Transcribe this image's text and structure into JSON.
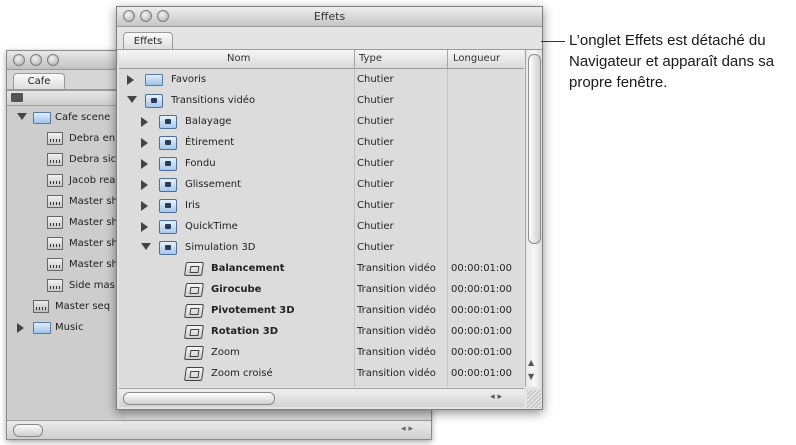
{
  "back_window": {
    "tab": "Cafe",
    "items": [
      {
        "label": "Cafe scene",
        "kind": "folder",
        "expanded": true
      },
      {
        "label": "Debra en",
        "kind": "clip"
      },
      {
        "label": "Debra sic",
        "kind": "clip"
      },
      {
        "label": "Jacob rea",
        "kind": "clip"
      },
      {
        "label": "Master sh",
        "kind": "clip"
      },
      {
        "label": "Master sh",
        "kind": "clip"
      },
      {
        "label": "Master sh",
        "kind": "clip"
      },
      {
        "label": "Master sh",
        "kind": "clip"
      },
      {
        "label": "Side mas",
        "kind": "clip"
      },
      {
        "label": "Master seq",
        "kind": "sequence"
      },
      {
        "label": "Music",
        "kind": "folder",
        "expanded": false
      }
    ]
  },
  "front_window": {
    "title": "Effets",
    "tab": "Effets",
    "columns": {
      "name": "Nom",
      "type": "Type",
      "length": "Longueur"
    },
    "rows": [
      {
        "name": "Favoris",
        "type": "Chutier",
        "length": "",
        "level": 0,
        "icon": "folder",
        "disclosure": "collapsed",
        "bold": false
      },
      {
        "name": "Transitions vidéo",
        "type": "Chutier",
        "length": "",
        "level": 0,
        "icon": "lock-folder",
        "disclosure": "expanded",
        "bold": false
      },
      {
        "name": "Balayage",
        "type": "Chutier",
        "length": "",
        "level": 1,
        "icon": "lock-folder",
        "disclosure": "collapsed",
        "bold": false
      },
      {
        "name": "Étirement",
        "type": "Chutier",
        "length": "",
        "level": 1,
        "icon": "lock-folder",
        "disclosure": "collapsed",
        "bold": false
      },
      {
        "name": "Fondu",
        "type": "Chutier",
        "length": "",
        "level": 1,
        "icon": "lock-folder",
        "disclosure": "collapsed",
        "bold": false
      },
      {
        "name": "Glissement",
        "type": "Chutier",
        "length": "",
        "level": 1,
        "icon": "lock-folder",
        "disclosure": "collapsed",
        "bold": false
      },
      {
        "name": "Iris",
        "type": "Chutier",
        "length": "",
        "level": 1,
        "icon": "lock-folder",
        "disclosure": "collapsed",
        "bold": false
      },
      {
        "name": "QuickTime",
        "type": "Chutier",
        "length": "",
        "level": 1,
        "icon": "lock-folder",
        "disclosure": "collapsed",
        "bold": false
      },
      {
        "name": "Simulation 3D",
        "type": "Chutier",
        "length": "",
        "level": 1,
        "icon": "lock-folder",
        "disclosure": "expanded",
        "bold": false
      },
      {
        "name": "Balancement",
        "type": "Transition vidéo",
        "length": "00:00:01:00",
        "level": 2,
        "icon": "transition",
        "disclosure": "none",
        "bold": true
      },
      {
        "name": "Girocube",
        "type": "Transition vidéo",
        "length": "00:00:01:00",
        "level": 2,
        "icon": "transition",
        "disclosure": "none",
        "bold": true
      },
      {
        "name": "Pivotement 3D",
        "type": "Transition vidéo",
        "length": "00:00:01:00",
        "level": 2,
        "icon": "transition",
        "disclosure": "none",
        "bold": true
      },
      {
        "name": "Rotation 3D",
        "type": "Transition vidéo",
        "length": "00:00:01:00",
        "level": 2,
        "icon": "transition",
        "disclosure": "none",
        "bold": true
      },
      {
        "name": "Zoom",
        "type": "Transition vidéo",
        "length": "00:00:01:00",
        "level": 2,
        "icon": "transition",
        "disclosure": "none",
        "bold": false
      },
      {
        "name": "Zoom croisé",
        "type": "Transition vidéo",
        "length": "00:00:01:00",
        "level": 2,
        "icon": "transition",
        "disclosure": "none",
        "bold": false
      }
    ]
  },
  "annotation": {
    "text": "L’onglet Effets est détaché du Navigateur et apparaît dans sa propre fenêtre."
  }
}
